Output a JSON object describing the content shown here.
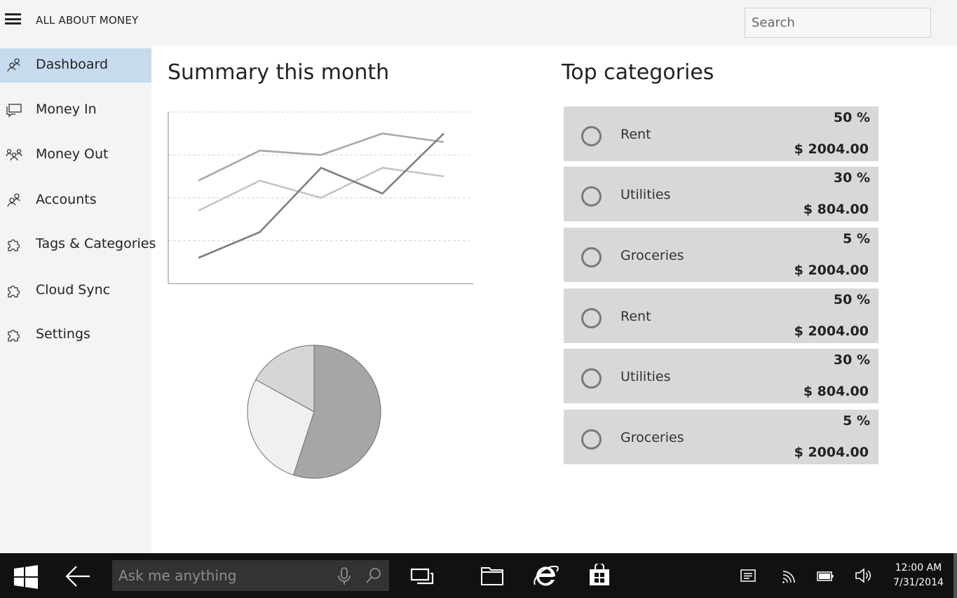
{
  "app": {
    "title": "ALL ABOUT MONEY"
  },
  "search": {
    "placeholder": "Search"
  },
  "sidebar": {
    "items": [
      {
        "label": "Dashboard",
        "icon": "person-icon",
        "active": true
      },
      {
        "label": "Money In",
        "icon": "chat-icon",
        "active": false
      },
      {
        "label": "Money Out",
        "icon": "people-icon",
        "active": false
      },
      {
        "label": "Accounts",
        "icon": "person-icon",
        "active": false
      },
      {
        "label": "Tags & Categories",
        "icon": "puzzle-icon",
        "active": false
      },
      {
        "label": "Cloud Sync",
        "icon": "puzzle-icon",
        "active": false
      },
      {
        "label": "Settings",
        "icon": "puzzle-icon",
        "active": false
      }
    ]
  },
  "summary": {
    "title": "Summary this month"
  },
  "top_categories": {
    "title": "Top categories",
    "items": [
      {
        "name": "Rent",
        "percent": "50 %",
        "amount": "$ 2004.00"
      },
      {
        "name": "Utilities",
        "percent": "30 %",
        "amount": "$ 804.00"
      },
      {
        "name": "Groceries",
        "percent": "5 %",
        "amount": "$ 2004.00"
      },
      {
        "name": "Rent",
        "percent": "50 %",
        "amount": "$ 2004.00"
      },
      {
        "name": "Utilities",
        "percent": "30 %",
        "amount": "$ 804.00"
      },
      {
        "name": "Groceries",
        "percent": "5 %",
        "amount": "$ 2004.00"
      }
    ]
  },
  "chart_data": [
    {
      "type": "line",
      "title": "",
      "xlabel": "",
      "ylabel": "",
      "x": [
        1,
        2,
        3,
        4,
        5
      ],
      "ylim": [
        0,
        4
      ],
      "grid": true,
      "series": [
        {
          "values": [
            2.4,
            3.1,
            3.0,
            3.5,
            3.3
          ],
          "color": "#a8a8a8"
        },
        {
          "values": [
            1.7,
            2.4,
            2.0,
            2.7,
            2.5
          ],
          "color": "#c4c4c4"
        },
        {
          "values": [
            0.6,
            1.2,
            2.7,
            2.1,
            3.5
          ],
          "color": "#7e7e7e"
        }
      ]
    },
    {
      "type": "pie",
      "title": "",
      "slices": [
        {
          "value": 55,
          "color": "#a6a6a6"
        },
        {
          "value": 28,
          "color": "#f0f0f0"
        },
        {
          "value": 17,
          "color": "#d6d6d6"
        }
      ]
    }
  ],
  "taskbar": {
    "cortana_placeholder": "Ask me anything",
    "time": "12:00 AM",
    "date": "7/31/2014"
  }
}
